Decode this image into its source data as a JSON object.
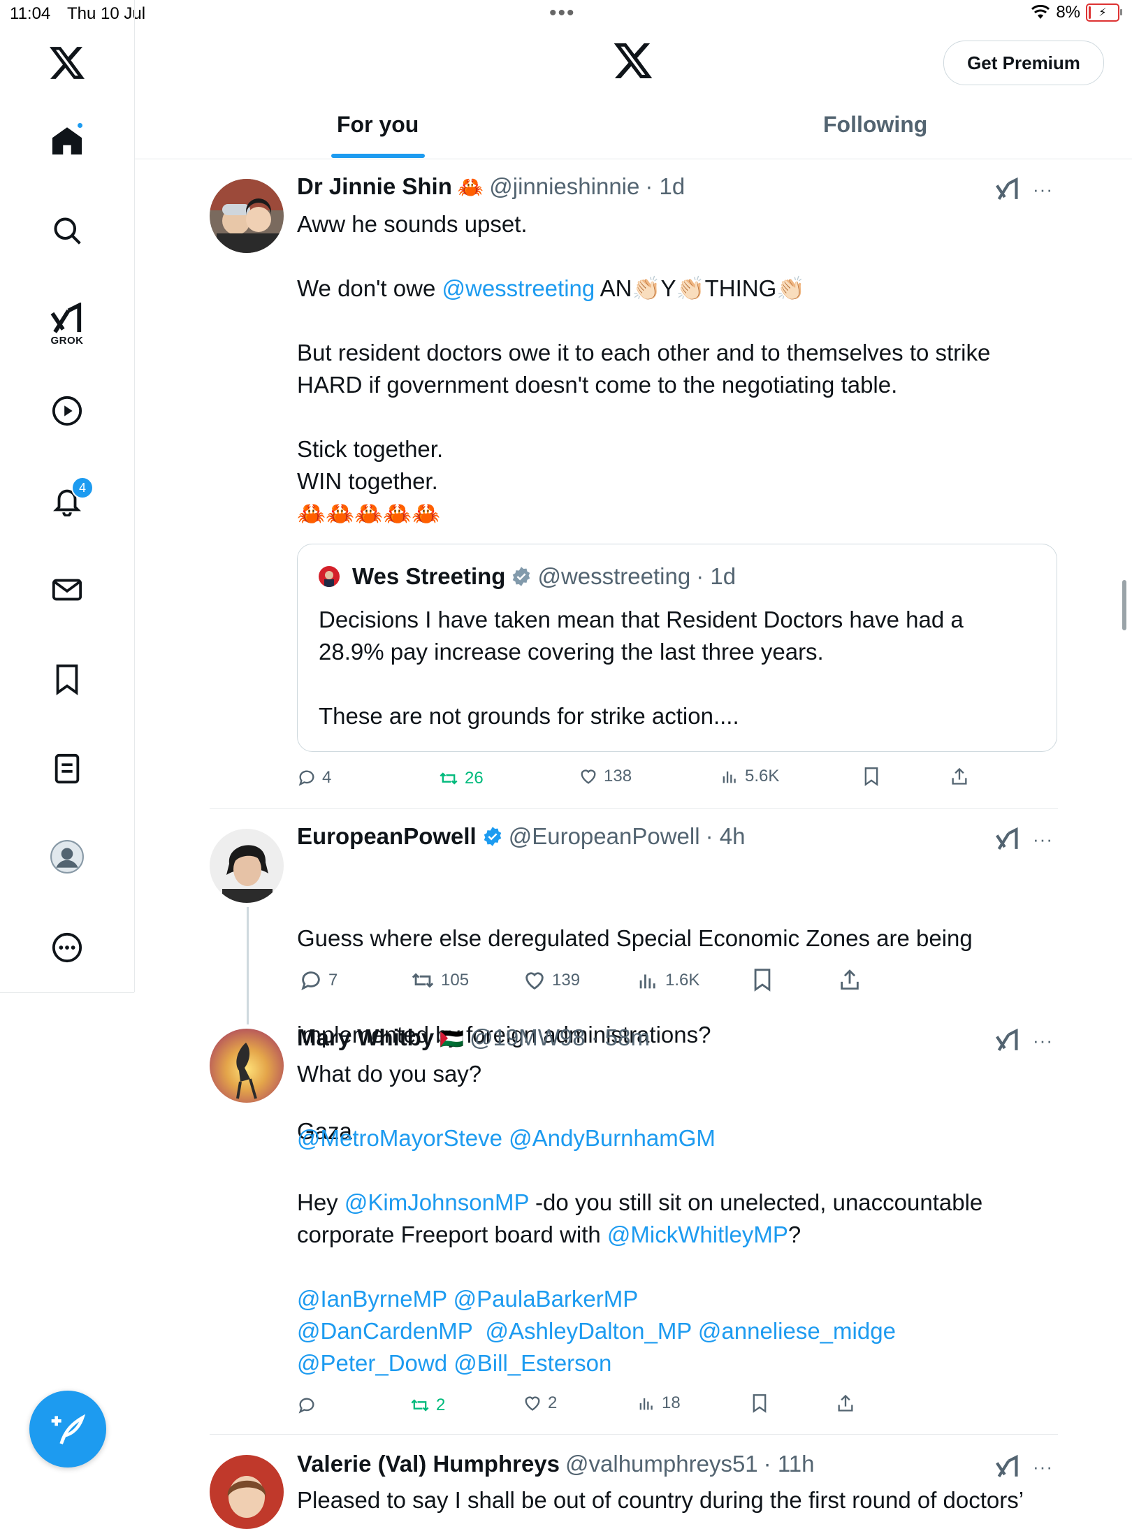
{
  "status_bar": {
    "time": "11:04",
    "date": "Thu 10 Jul",
    "battery": "8%",
    "battery_fraction": 0.08
  },
  "sidebar": {
    "items": [
      {
        "name": "home-icon"
      },
      {
        "name": "search-icon"
      },
      {
        "name": "grok-icon",
        "label": "GROK"
      },
      {
        "name": "video-icon"
      },
      {
        "name": "notifications-icon",
        "badge": "4"
      },
      {
        "name": "messages-icon"
      },
      {
        "name": "bookmarks-icon"
      },
      {
        "name": "lists-icon"
      },
      {
        "name": "profile-icon"
      },
      {
        "name": "more-icon"
      }
    ]
  },
  "header": {
    "premium_label": "Get Premium",
    "tabs": [
      {
        "label": "For you",
        "active": true
      },
      {
        "label": "Following",
        "active": false
      }
    ]
  },
  "posts": [
    {
      "name": "Dr Jinnie Shin",
      "emoji": "🦀",
      "handle": "@jinnieshinnie",
      "time": "· 1d",
      "lines": [
        {
          "parts": [
            {
              "t": "Aww he sounds upset."
            }
          ]
        },
        {
          "parts": []
        },
        {
          "parts": [
            {
              "t": "We don't owe "
            },
            {
              "t": "@wesstreeting",
              "m": true
            },
            {
              "t": " AN👏🏻Y👏🏻THING👏🏻"
            }
          ]
        },
        {
          "parts": []
        },
        {
          "parts": [
            {
              "t": "But resident doctors owe it to each other and to themselves to strike"
            }
          ]
        },
        {
          "parts": [
            {
              "t": "HARD if government doesn't come to the negotiating table."
            }
          ]
        },
        {
          "parts": []
        },
        {
          "parts": [
            {
              "t": "Stick together."
            }
          ]
        },
        {
          "parts": [
            {
              "t": "WIN together."
            }
          ]
        },
        {
          "parts": [
            {
              "t": "🦀🦀🦀🦀🦀"
            }
          ]
        }
      ],
      "quote": {
        "name": "Wes Streeting",
        "handle": "@wesstreeting",
        "time": "· 1d",
        "lines": [
          "Decisions I have taken mean that Resident Doctors have had a",
          "28.9% pay increase covering the last three years.",
          "",
          "These are not grounds for strike action...."
        ]
      },
      "stats": {
        "replies": "4",
        "reposts": "26",
        "likes": "138",
        "views": "5.6K"
      }
    },
    {
      "name": "EuropeanPowell",
      "handle": "@EuropeanPowell",
      "time": "· 4h",
      "lines": [
        "Guess where else deregulated Special Economic Zones are being",
        "implemented by foreign administrations?",
        "Gaza."
      ],
      "stats": {
        "replies": "7",
        "reposts": "105",
        "likes": "139",
        "views": "1.6K"
      }
    },
    {
      "name": "Mary Whitby",
      "emoji": "🇵🇸",
      "handle": "@19MW98",
      "time": "· 58m",
      "lines": [
        {
          "parts": [
            {
              "t": "What do you say?"
            }
          ]
        },
        {
          "parts": []
        },
        {
          "parts": [
            {
              "t": "@MetroMayorSteve",
              "m": true
            },
            {
              "t": " "
            },
            {
              "t": "@AndyBurnhamGM",
              "m": true
            }
          ]
        },
        {
          "parts": []
        },
        {
          "parts": [
            {
              "t": "Hey "
            },
            {
              "t": "@KimJohnsonMP",
              "m": true
            },
            {
              "t": " -do you still sit on unelected, unaccountable"
            }
          ]
        },
        {
          "parts": [
            {
              "t": "corporate Freeport board with "
            },
            {
              "t": "@MickWhitleyMP",
              "m": true
            },
            {
              "t": "?"
            }
          ]
        },
        {
          "parts": []
        },
        {
          "parts": [
            {
              "t": "@IanByrneMP",
              "m": true
            },
            {
              "t": " "
            },
            {
              "t": "@PaulaBarkerMP",
              "m": true
            }
          ]
        },
        {
          "parts": [
            {
              "t": "@DanCardenMP",
              "m": true
            },
            {
              "t": "  "
            },
            {
              "t": "@AshleyDalton_MP",
              "m": true
            },
            {
              "t": " "
            },
            {
              "t": "@anneliese_midge",
              "m": true
            }
          ]
        },
        {
          "parts": [
            {
              "t": "@Peter_Dowd",
              "m": true
            },
            {
              "t": " "
            },
            {
              "t": "@Bill_Esterson",
              "m": true
            }
          ]
        }
      ],
      "stats": {
        "replies": "",
        "reposts": "2",
        "likes": "2",
        "views": "18"
      }
    },
    {
      "name": "Valerie (Val) Humphreys",
      "handle": "@valhumphreys51",
      "time": "· 11h",
      "lines": [
        "Pleased to say I shall be out of country during the first round of doctors’"
      ]
    }
  ],
  "colors": {
    "accent": "#1d9bf0",
    "repost_green": "#00ba7c",
    "muted": "#536471"
  }
}
